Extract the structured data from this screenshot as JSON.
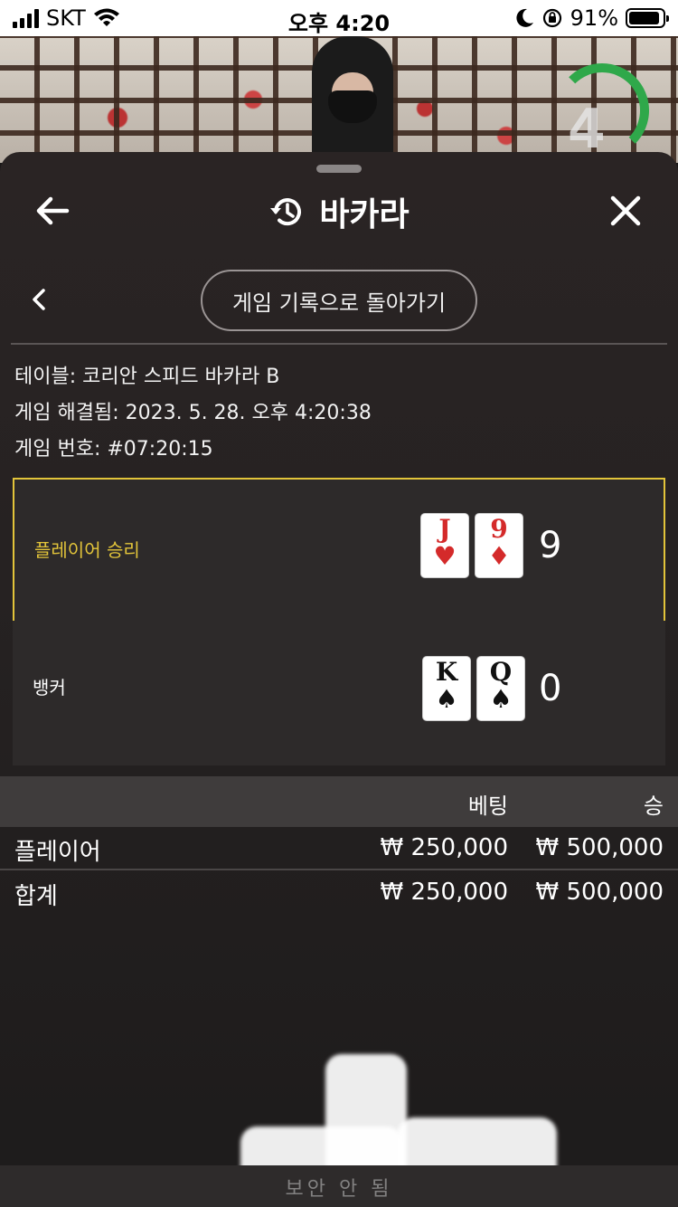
{
  "status_bar": {
    "carrier": "SKT",
    "time": "오후 4:20",
    "battery": "91%",
    "battery_level": 0.91
  },
  "video": {
    "timer": "4"
  },
  "header": {
    "title": "바카라"
  },
  "nav": {
    "back_to_history": "게임 기록으로 돌아가기"
  },
  "game_info": {
    "table": "테이블: 코리안 스피드 바카라 B",
    "resolved": "게임 해결됨: 2023. 5. 28. 오후 4:20:38",
    "number": "게임 번호: #07:20:15"
  },
  "results": {
    "player": {
      "label": "플레이어 승리",
      "cards": [
        {
          "rank": "J",
          "suit": "♥",
          "color": "#d42a2a"
        },
        {
          "rank": "9",
          "suit": "♦",
          "color": "#d42a2a"
        }
      ],
      "score": "9"
    },
    "banker": {
      "label": "뱅커",
      "cards": [
        {
          "rank": "K",
          "suit": "♠",
          "color": "#111111"
        },
        {
          "rank": "Q",
          "suit": "♠",
          "color": "#111111"
        }
      ],
      "score": "0"
    }
  },
  "bets": {
    "headers": {
      "bet": "베팅",
      "win": "승"
    },
    "rows": [
      {
        "label": "플레이어",
        "bet": "₩ 250,000",
        "win": "₩ 500,000"
      },
      {
        "label": "합계",
        "bet": "₩ 250,000",
        "win": "₩ 500,000"
      }
    ]
  },
  "footer": {
    "text": "보안 안 됨"
  },
  "colors": {
    "accent_gold": "#e2c43a",
    "timer_green": "#2fa84a",
    "card_red": "#d42a2a"
  }
}
